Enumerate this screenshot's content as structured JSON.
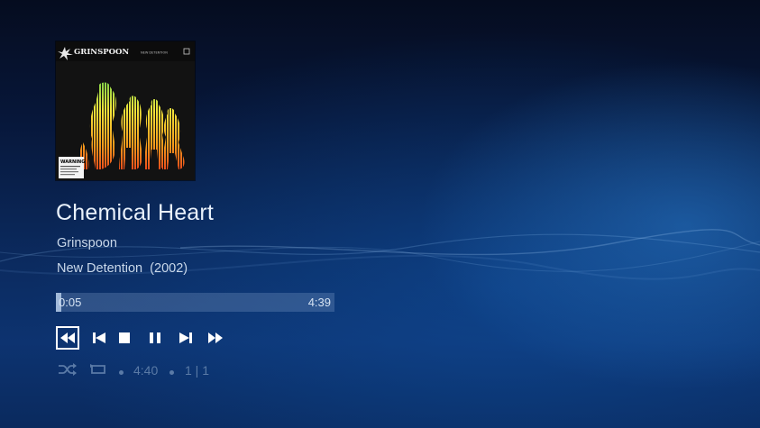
{
  "now_playing": {
    "title": "Chemical Heart",
    "artist": "Grinspoon",
    "album": "New Detention",
    "year": "(2002)"
  },
  "cover_art": {
    "band_logo_text": "GRINSPOON",
    "album_small_text": "NEW DETENTION",
    "sticker_text": "WARNING"
  },
  "progress": {
    "elapsed": "0:05",
    "total": "4:39",
    "fraction": 0.018
  },
  "controls": {
    "items": [
      "rewind",
      "previous",
      "stop",
      "pause",
      "next",
      "fast-forward"
    ],
    "selected": "rewind"
  },
  "status": {
    "duration": "4:40",
    "track_position": "1 | 1"
  },
  "colors": {
    "accent_text": "#e9f1fb",
    "secondary_text": "#c9d8ea",
    "dim_text": "#5a7aa6"
  }
}
